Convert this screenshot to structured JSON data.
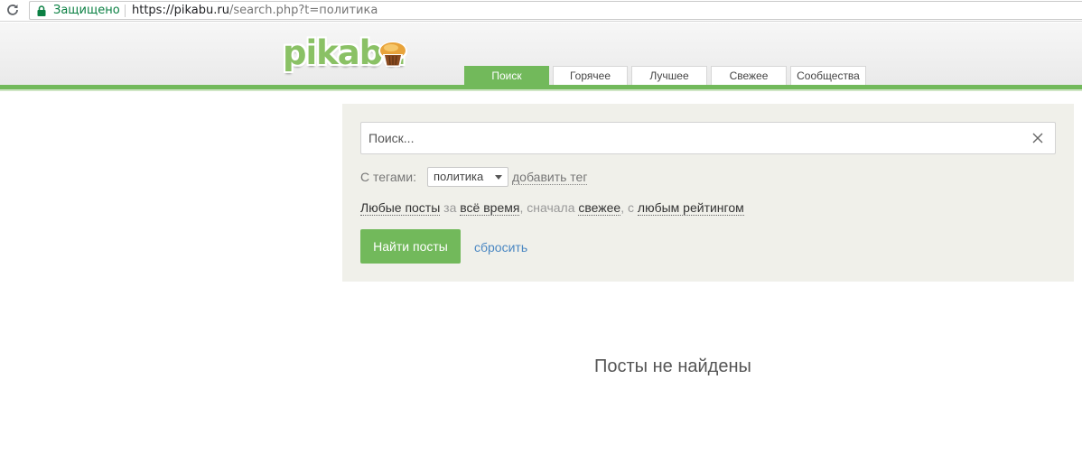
{
  "browser": {
    "secure_label": "Защищено",
    "url_host": "https://pikabu.ru",
    "url_path": "/search.php?t=политика"
  },
  "header": {
    "logo_text": "pikabu",
    "tabs": [
      {
        "label": "Поиск",
        "active": true
      },
      {
        "label": "Горячее",
        "active": false
      },
      {
        "label": "Лучшее",
        "active": false
      },
      {
        "label": "Свежее",
        "active": false
      },
      {
        "label": "Сообщества",
        "active": false
      }
    ]
  },
  "search": {
    "placeholder": "Поиск...",
    "value": "",
    "tags_label": "С тегами:",
    "tag_selected": "политика",
    "add_tag_label": "добавить тег",
    "filter": {
      "posts": "Любые посты",
      "for_word": " за ",
      "period": "всё время",
      "sort_word": ", сначала ",
      "sort": "свежее",
      "with_word": ", с ",
      "rating": "любым рейтингом"
    },
    "find_button": "Найти посты",
    "reset_link": "сбросить"
  },
  "results": {
    "empty_message": "Посты не найдены"
  },
  "colors": {
    "accent_green": "#72b95b",
    "link_blue": "#4a87c2",
    "panel_bg": "#f0f0ea"
  }
}
